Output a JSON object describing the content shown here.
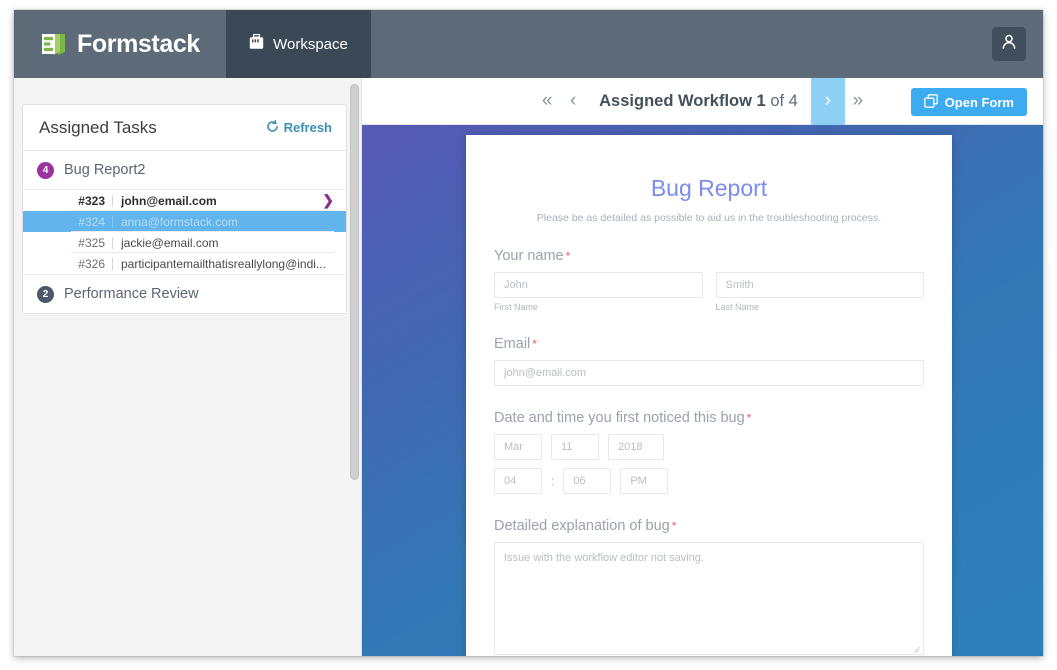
{
  "topbar": {
    "brand_name": "Formstack",
    "brand_logo_icon": "formstack-logo-icon",
    "workspace_tab_label": "Workspace",
    "workspace_tab_icon": "briefcase-icon",
    "avatar_icon": "person-icon"
  },
  "sidebar": {
    "title": "Assigned Tasks",
    "refresh_label": "Refresh",
    "refresh_icon": "refresh-icon",
    "groups": [
      {
        "badge": "4",
        "badge_color": "#9a33a0",
        "label": "Bug Report2",
        "items": [
          {
            "id": "#323",
            "email": "john@email.com",
            "state": "unread",
            "chevron_icon": "chevron-right-icon"
          },
          {
            "id": "#324",
            "email": "anna@formstack.com",
            "state": "selected",
            "chevron_icon": ""
          },
          {
            "id": "#325",
            "email": "jackie@email.com",
            "state": "normal",
            "chevron_icon": ""
          },
          {
            "id": "#326",
            "email": "participantemailthatisreallylong@indi...",
            "state": "normal",
            "chevron_icon": ""
          }
        ]
      },
      {
        "badge": "2",
        "badge_color": "#4b5a68",
        "label": "Performance Review",
        "items": []
      }
    ]
  },
  "nav": {
    "first_icon": "double-chevron-left-icon",
    "prev_icon": "chevron-left-icon",
    "next_icon": "chevron-right-icon",
    "last_icon": "double-chevron-right-icon",
    "label_prefix": "Assigned Workflow",
    "current_page": "1",
    "of_text": "of",
    "total_pages": "4",
    "open_form_label": "Open Form",
    "open_form_icon": "copy-windows-icon",
    "accent_color": "#3dabf0"
  },
  "form": {
    "title": "Bug Report",
    "subtitle": "Please be as detailed as possible to aid us in the troubleshooting process.",
    "title_color": "#7b8cea",
    "required_marker": "*",
    "fields": {
      "name": {
        "label": "Your name",
        "first_value": "John",
        "last_value": "Smith",
        "first_sublabel": "First Name",
        "last_sublabel": "Last Name"
      },
      "email": {
        "label": "Email",
        "value": "john@email.com"
      },
      "datetime": {
        "label": "Date and time you first noticed this bug",
        "month": "Mar",
        "day": "11",
        "year": "2018",
        "hour": "04",
        "separator": ":",
        "minute": "06",
        "meridiem": "PM"
      },
      "explanation": {
        "label": "Detailed explanation of bug",
        "value": "Issue with the workflow editor not saving."
      }
    }
  }
}
